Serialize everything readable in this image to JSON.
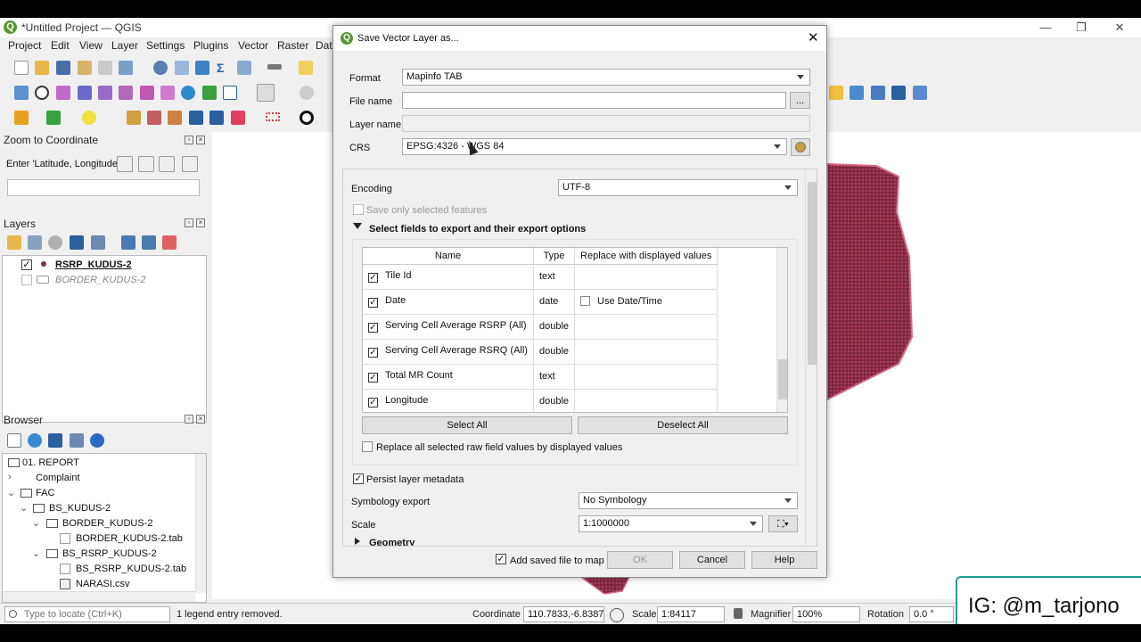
{
  "window": {
    "title": "*Untitled Project — QGIS",
    "controls": {
      "minimize": "—",
      "restore": "❐",
      "close": "✕"
    }
  },
  "menubar": [
    "Project",
    "Edit",
    "View",
    "Layer",
    "Settings",
    "Plugins",
    "Vector",
    "Raster",
    "Data"
  ],
  "zoom_panel": {
    "title": "Zoom to Coordinate",
    "label": "Enter 'Latitude, Longitude'",
    "input_value": ""
  },
  "layers_panel": {
    "title": "Layers",
    "items": [
      {
        "name": "RSRP_KUDUS-2",
        "checked": true
      },
      {
        "name": "BORDER_KUDUS-2",
        "checked": false
      }
    ]
  },
  "browser_panel": {
    "title": "Browser",
    "tree": [
      {
        "label": "01. REPORT",
        "level": 0,
        "type": "folder"
      },
      {
        "label": "Complaint",
        "level": 0,
        "type": "folder"
      },
      {
        "label": "FAC",
        "level": 0,
        "type": "folder"
      },
      {
        "label": "BS_KUDUS-2",
        "level": 1,
        "type": "folder"
      },
      {
        "label": "BORDER_KUDUS-2",
        "level": 2,
        "type": "folder"
      },
      {
        "label": "BORDER_KUDUS-2.tab",
        "level": 3,
        "type": "file"
      },
      {
        "label": "BS_RSRP_KUDUS-2",
        "level": 2,
        "type": "folder"
      },
      {
        "label": "BS_RSRP_KUDUS-2.tab",
        "level": 3,
        "type": "file"
      },
      {
        "label": "NARASI.csv",
        "level": 3,
        "type": "file"
      }
    ]
  },
  "dialog": {
    "title": "Save Vector Layer as...",
    "format_label": "Format",
    "format_value": "Mapinfo TAB",
    "filename_label": "File name",
    "filename_value": "",
    "browse_label": "...",
    "layername_label": "Layer name",
    "layername_value": "",
    "crs_label": "CRS",
    "crs_value": "EPSG:4326 - WGS 84",
    "encoding_label": "Encoding",
    "encoding_value": "UTF-8",
    "save_selected_label": "Save only selected features",
    "fields_section_label": "Select fields to export and their export options",
    "columns": [
      "Name",
      "Type",
      "Replace with displayed values"
    ],
    "fields": [
      {
        "name": "Tile Id",
        "type": "text",
        "replace": ""
      },
      {
        "name": "Date",
        "type": "date",
        "replace": "Use Date/Time"
      },
      {
        "name": "Serving Cell Average RSRP (All)",
        "type": "double",
        "replace": ""
      },
      {
        "name": "Serving Cell Average RSRQ (All)",
        "type": "double",
        "replace": ""
      },
      {
        "name": "Total MR Count",
        "type": "text",
        "replace": ""
      },
      {
        "name": "Longitude",
        "type": "double",
        "replace": ""
      }
    ],
    "select_all_label": "Select All",
    "deselect_all_label": "Deselect All",
    "replace_all_label": "Replace all selected raw field values by displayed values",
    "persist_label": "Persist layer metadata",
    "symbology_label": "Symbology export",
    "symbology_value": "No Symbology",
    "scale_label": "Scale",
    "scale_value": "1:1000000",
    "geometry_label": "Geometry",
    "add_to_map_label": "Add saved file to map",
    "ok_label": "OK",
    "cancel_label": "Cancel",
    "help_label": "Help"
  },
  "statusbar": {
    "locate_placeholder": "Type to locate (Ctrl+K)",
    "message": "1 legend entry removed.",
    "coordinate_label": "Coordinate",
    "coordinate_value": "110.7833,-6.8387",
    "scale_label": "Scale",
    "scale_value": "1:84117",
    "magnifier_label": "Magnifier",
    "magnifier_value": "100%",
    "rotation_label": "Rotation",
    "rotation_value": "0.0 °"
  },
  "watermark": "IG: @m_tarjono",
  "colors": {
    "map_feature": "#8b2a45",
    "map_feature_edge": "#d86a86",
    "qgis_green": "#589632",
    "watermark_border": "#20a090"
  }
}
